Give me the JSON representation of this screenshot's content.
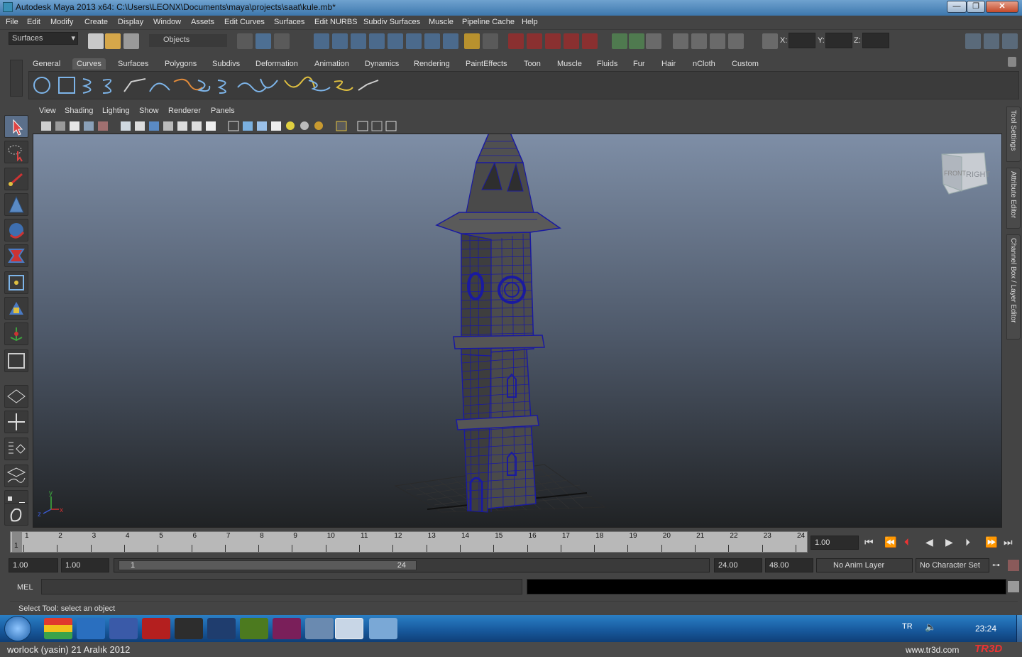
{
  "window": {
    "title": "Autodesk Maya 2013 x64: C:\\Users\\LEONX\\Documents\\maya\\projects\\saat\\kule.mb*",
    "minimize": "—",
    "maximize": "❐",
    "close": "✕"
  },
  "menubar": [
    "File",
    "Edit",
    "Modify",
    "Create",
    "Display",
    "Window",
    "Assets",
    "Edit Curves",
    "Surfaces",
    "Edit NURBS",
    "Subdiv Surfaces",
    "Muscle",
    "Pipeline Cache",
    "Help"
  ],
  "statusline": {
    "menuset": "Surfaces",
    "selection_mode": "Objects",
    "x_label": "X:",
    "y_label": "Y:",
    "z_label": "Z:"
  },
  "shelf": {
    "tabs": [
      "General",
      "Curves",
      "Surfaces",
      "Polygons",
      "Subdivs",
      "Deformation",
      "Animation",
      "Dynamics",
      "Rendering",
      "PaintEffects",
      "Toon",
      "Muscle",
      "Fluids",
      "Fur",
      "Hair",
      "nCloth",
      "Custom"
    ],
    "active_tab": "Curves"
  },
  "panel": {
    "menus": [
      "View",
      "Shading",
      "Lighting",
      "Show",
      "Renderer",
      "Panels"
    ]
  },
  "viewcube": {
    "front": "FRONT",
    "right": "RIGHT"
  },
  "axis": {
    "y": "y",
    "x": "x",
    "z": "z"
  },
  "side_tabs": [
    "Tool Settings",
    "Attribute Editor",
    "Channel Box / Layer Editor"
  ],
  "timeslider": {
    "ticks": [
      "1",
      "2",
      "3",
      "4",
      "5",
      "6",
      "7",
      "8",
      "9",
      "10",
      "11",
      "12",
      "13",
      "14",
      "15",
      "16",
      "17",
      "18",
      "19",
      "20",
      "21",
      "22",
      "23",
      "24"
    ],
    "current_frame_marker": "1",
    "current_time": "1.00"
  },
  "range": {
    "start_time": "1.00",
    "playback_start": "1.00",
    "range_start": "1",
    "range_end": "24",
    "playback_end": "24.00",
    "end_time": "48.00",
    "anim_layer": "No Anim Layer",
    "character_set": "No Character Set"
  },
  "command_line": {
    "label": "MEL"
  },
  "help_line": "Select Tool: select an object",
  "taskbar": {
    "language": "TR",
    "clock": "23:24",
    "apps": [
      "Chrome",
      "Autodesk",
      "Link",
      "Fl",
      "Fe",
      "Ps",
      "Dw",
      "Id",
      "Paint",
      "Maya",
      "Explorer"
    ]
  },
  "caption": {
    "left": "worlock (yasin)  21 Aralık 2012",
    "site": "www.tr3d.com",
    "logo": "TR3D"
  },
  "colors": {
    "ui_bg": "#444444",
    "wireframe": "#1a1aa0",
    "taskbar": "#1c5fa5",
    "timeslider": "#b8b8b8"
  }
}
